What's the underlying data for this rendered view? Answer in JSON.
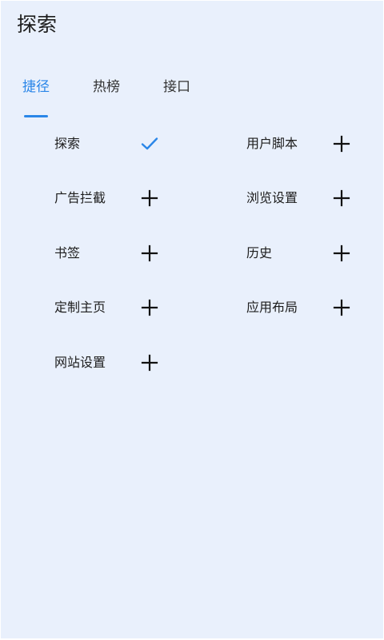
{
  "page": {
    "title": "探索"
  },
  "tabs": [
    {
      "label": "捷径",
      "active": true
    },
    {
      "label": "热榜",
      "active": false
    },
    {
      "label": "接口",
      "active": false
    }
  ],
  "colors": {
    "accent": "#2a86e8",
    "background": "#e9f0fc",
    "text": "#1d1d1d"
  },
  "shortcuts": [
    {
      "label": "探索",
      "action": "check-icon",
      "added": true
    },
    {
      "label": "用户脚本",
      "action": "plus-icon",
      "added": false
    },
    {
      "label": "广告拦截",
      "action": "plus-icon",
      "added": false
    },
    {
      "label": "浏览设置",
      "action": "plus-icon",
      "added": false
    },
    {
      "label": "书签",
      "action": "plus-icon",
      "added": false
    },
    {
      "label": "历史",
      "action": "plus-icon",
      "added": false
    },
    {
      "label": "定制主页",
      "action": "plus-icon",
      "added": false
    },
    {
      "label": "应用布局",
      "action": "plus-icon",
      "added": false
    },
    {
      "label": "网站设置",
      "action": "plus-icon",
      "added": false
    }
  ]
}
